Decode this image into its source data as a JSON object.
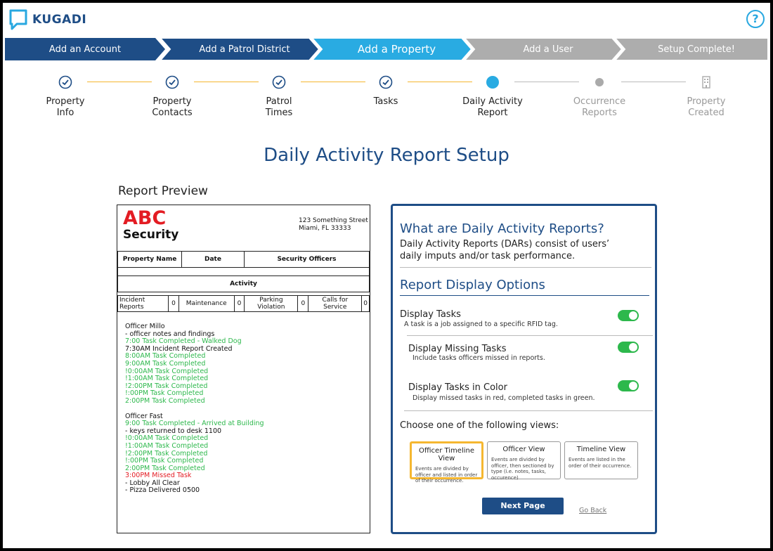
{
  "app": {
    "name": "KUGADI",
    "help": "?"
  },
  "wizard": [
    {
      "label": "Add an Account",
      "state": "done"
    },
    {
      "label": "Add a Patrol District",
      "state": "done"
    },
    {
      "label": "Add a Property",
      "state": "current"
    },
    {
      "label": "Add a User",
      "state": "todo"
    },
    {
      "label": "Setup Complete!",
      "state": "todo"
    }
  ],
  "substeps": [
    {
      "label": "Property\nInfo",
      "state": "done"
    },
    {
      "label": "Property\nContacts",
      "state": "done"
    },
    {
      "label": "Patrol\nTimes",
      "state": "done"
    },
    {
      "label": "Tasks",
      "state": "done"
    },
    {
      "label": "Daily Activity\nReport",
      "state": "current"
    },
    {
      "label": "Occurrence\nReports",
      "state": "todo"
    },
    {
      "label": "Property\nCreated",
      "state": "final"
    }
  ],
  "page_title": "Daily Activity Report Setup",
  "preview": {
    "title": "Report Preview",
    "logo_line1": "ABC",
    "logo_line2": "Security",
    "address_line1": "123 Something Street",
    "address_line2": "Miami, FL 33333",
    "col_property": "Property Name",
    "col_date": "Date",
    "col_officers": "Security Officers",
    "activity": "Activity",
    "counts": [
      {
        "label": "Incident Reports",
        "value": "0"
      },
      {
        "label": "Maintenance",
        "value": "0"
      },
      {
        "label": "Parking Violation",
        "value": "0"
      },
      {
        "label": "Calls for Service",
        "value": "0"
      }
    ],
    "log": [
      {
        "text": "Officer Millo",
        "color": "black"
      },
      {
        "text": "- officer notes and findings",
        "color": "black"
      },
      {
        "text": "7:00 Task Completed - Walked Dog",
        "color": "green"
      },
      {
        "text": "7:30AM Incident Report Created",
        "color": "black"
      },
      {
        "text": "8:00AM Task Completed",
        "color": "green"
      },
      {
        "text": "9:00AM Task Completed",
        "color": "green"
      },
      {
        "text": "!0:00AM Task Completed",
        "color": "green"
      },
      {
        "text": "!1:00AM Task Completed",
        "color": "green"
      },
      {
        "text": "!2:00PM Task Completed",
        "color": "green"
      },
      {
        "text": "!:00PM Task Completed",
        "color": "green"
      },
      {
        "text": "2:00PM Task Completed",
        "color": "green"
      },
      {
        "text": "",
        "color": "gap"
      },
      {
        "text": "Officer Fast",
        "color": "black"
      },
      {
        "text": "9:00 Task Completed - Arrived at Building",
        "color": "green"
      },
      {
        "text": "- keys returned to desk 1100",
        "color": "black"
      },
      {
        "text": "!0:00AM Task Completed",
        "color": "green"
      },
      {
        "text": "!1:00AM Task Completed",
        "color": "green"
      },
      {
        "text": "!2:00PM Task Completed",
        "color": "green"
      },
      {
        "text": "!:00PM Task Completed",
        "color": "green"
      },
      {
        "text": "2:00PM Task Completed",
        "color": "green"
      },
      {
        "text": "3:00PM Missed Task",
        "color": "red"
      },
      {
        "text": "- Lobby All Clear",
        "color": "black"
      },
      {
        "text": "- Pizza Delivered 0500",
        "color": "black"
      }
    ]
  },
  "panel": {
    "what_title": "What are Daily Activity Reports?",
    "what_text": "Daily Activity Reports (DARs) consist of users’ daily imputs and/or task performance.",
    "options_title": "Report Display Options",
    "display_tasks": {
      "label": "Display Tasks",
      "desc": "A task is a job assigned to a specific RFID tag.",
      "on": true
    },
    "display_missing": {
      "label": "Display Missing Tasks",
      "desc": "Include tasks officers missed in reports.",
      "on": true
    },
    "display_color": {
      "label": "Display Tasks in Color",
      "desc": "Display missed tasks in red, completed tasks in green.",
      "on": true
    },
    "choose_label": "Choose one of the following views:",
    "views": [
      {
        "title": "Officer Timeline View",
        "desc": "Events are divided by officer and listed in order of their occurrence.",
        "selected": true
      },
      {
        "title": "Officer View",
        "desc": "Events are divided by officer, then sectioned by type (i.e. notes, tasks, occurence)",
        "selected": false
      },
      {
        "title": "Timeline View",
        "desc": "Events are listed in the order of their occurrence.",
        "selected": false
      }
    ],
    "next_label": "Next Page",
    "back_label": "Go Back"
  },
  "colors": {
    "navy": "#1e4d86",
    "cyan": "#29abe2",
    "gray": "#adadad",
    "green": "#2db84c",
    "red": "#e31c23",
    "gold": "#f5b730"
  }
}
